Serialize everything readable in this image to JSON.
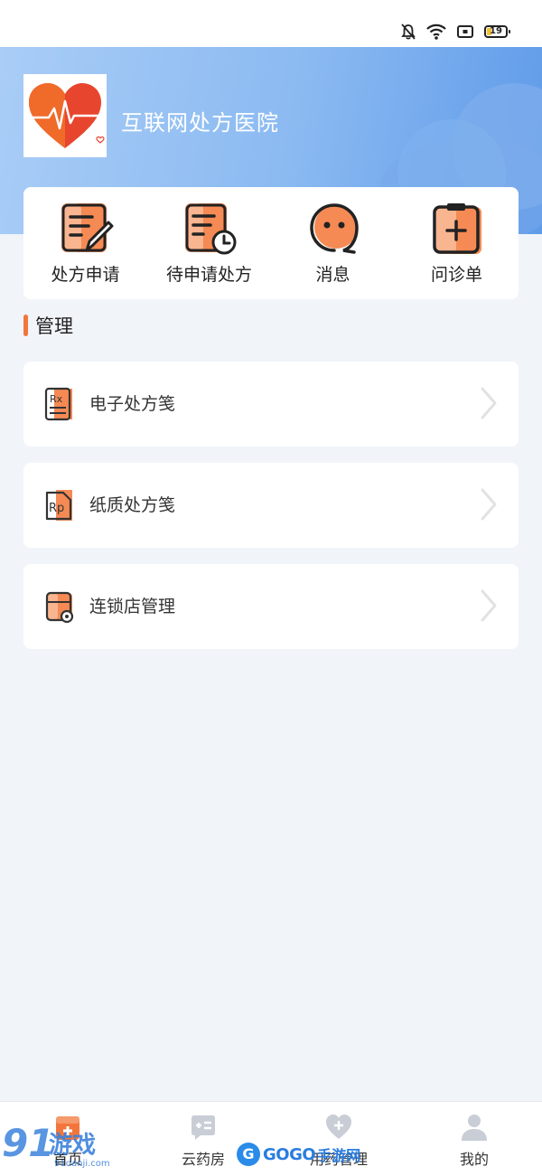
{
  "status_bar": {
    "battery_level": "19",
    "icons": [
      "bell-muted-icon",
      "wifi-icon",
      "screen-record-icon",
      "battery-icon"
    ]
  },
  "header": {
    "hospital_name": "互联网处方医院",
    "logo_icon": "heart-pulse-logo",
    "colors": {
      "gradient_start": "#a9cdf6",
      "gradient_end": "#5f9be9"
    }
  },
  "quick_actions": [
    {
      "label": "处方申请",
      "icon": "prescription-apply-icon"
    },
    {
      "label": "待申请处方",
      "icon": "pending-prescription-icon"
    },
    {
      "label": "消息",
      "icon": "message-icon"
    },
    {
      "label": "问诊单",
      "icon": "consultation-form-icon"
    }
  ],
  "management": {
    "title": "管理",
    "items": [
      {
        "label": "电子处方笺",
        "icon": "rx-document-icon"
      },
      {
        "label": "纸质处方笺",
        "icon": "rp-paper-icon"
      },
      {
        "label": "连锁店管理",
        "icon": "chain-store-settings-icon"
      }
    ]
  },
  "tab_bar": {
    "tabs": [
      {
        "label": "首页",
        "icon": "home-icon",
        "active": true
      },
      {
        "label": "云药房",
        "icon": "cloud-pharmacy-icon",
        "active": false
      },
      {
        "label": "用药管理",
        "icon": "health-heart-icon",
        "active": false
      },
      {
        "label": "我的",
        "icon": "profile-icon",
        "active": false
      }
    ]
  },
  "watermarks": {
    "left_number": "91",
    "left_text": "游戏",
    "left_url": "91danji.com",
    "center_brand": "GOGO",
    "center_sub": "手游网"
  },
  "colors": {
    "accent": "#f2763c",
    "background": "#f1f4f9"
  }
}
